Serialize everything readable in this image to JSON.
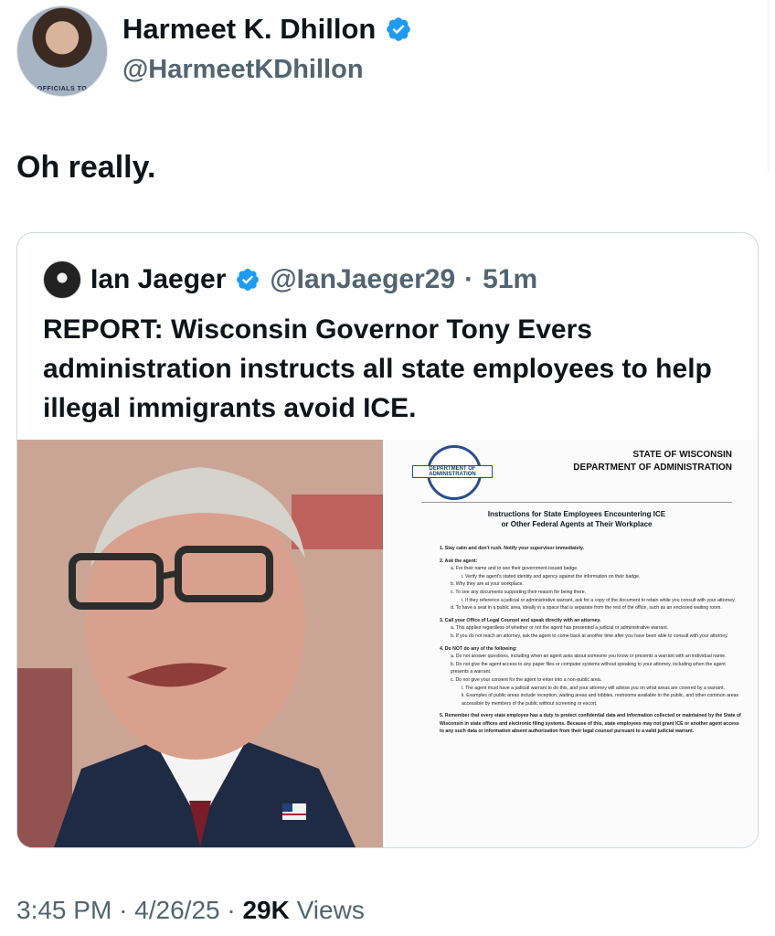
{
  "author": {
    "name": "Harmeet K. Dhillon",
    "handle": "@HarmeetKDhillon",
    "verified_icon": "verified-badge",
    "avatar_caption": "OFFICIALS TO"
  },
  "tweet": {
    "text": "Oh really."
  },
  "quote": {
    "name": "Ian Jaeger",
    "handle": "@IanJaeger29",
    "separator": "·",
    "time": "51m",
    "text": "REPORT: Wisconsin Governor Tony Evers administration instructs all state employees to help illegal immigrants avoid ICE."
  },
  "document": {
    "seal_text": "DEPARTMENT OF ADMINISTRATION",
    "state_line1": "STATE OF WISCONSIN",
    "state_line2": "DEPARTMENT OF ADMINISTRATION",
    "title_line1": "Instructions for State Employees Encountering ICE",
    "title_line2": "or Other Federal Agents at Their Workplace",
    "s1": "1.  Stay calm and don't rush. Notify your supervisor immediately.",
    "s2": "2.  Ask the agent:",
    "s2a": "a.  For their name and to see their government-issued badge.",
    "s2a1": "i.  Verify the agent's stated identity and agency against the information on their badge.",
    "s2b": "b.  Why they are at your workplace.",
    "s2c": "c.  To see any documents supporting their reason for being there.",
    "s2c1": "i.  If they reference a judicial or administrative warrant, ask for a copy of the document to retain while you consult with your attorney.",
    "s2d": "d.  To have a seat in a public area, ideally in a space that is separate from the rest of the office, such as an enclosed waiting room.",
    "s3": "3.  Call your Office of Legal Counsel and speak directly with an attorney.",
    "s3a": "a.  This applies regardless of whether or not the agent has presented a judicial or administrative warrant.",
    "s3b": "b.  If you do not reach an attorney, ask the agent to come back at another time after you have been able to consult with your attorney.",
    "s4": "4.  Do NOT do any of the following:",
    "s4a": "a.  Do not answer questions, including when an agent asks about someone you know or presents a warrant with an individual name.",
    "s4b": "b.  Do not give the agent access to any paper files or computer systems without speaking to your attorney, including when the agent presents a warrant.",
    "s4c": "c.  Do not give your consent for the agent to enter into a non-public area.",
    "s4c1": "i.  The agent must have a judicial warrant to do this, and your attorney will advise you on what areas are covered by a warrant.",
    "s4c2": "ii.  Examples of public areas include reception, waiting areas and lobbies, restrooms available to the public, and other common areas accessible by members of the public without screening or escort.",
    "s5": "5.  Remember that every state employee has a duty to protect confidential data and information collected or maintained by the State of Wisconsin in state offices and electronic filing systems. Because of this, state employees may not grant ICE or another agent access to any such data or information absent authorization from their legal counsel pursuant to a valid judicial warrant."
  },
  "footer": {
    "time": "3:45 PM",
    "sep": "·",
    "date": "4/26/25",
    "views_count": "29K",
    "views_label": "Views"
  },
  "colors": {
    "verified_blue": "#1d9bf0",
    "muted_text": "#536471",
    "border": "#cfd9de"
  }
}
